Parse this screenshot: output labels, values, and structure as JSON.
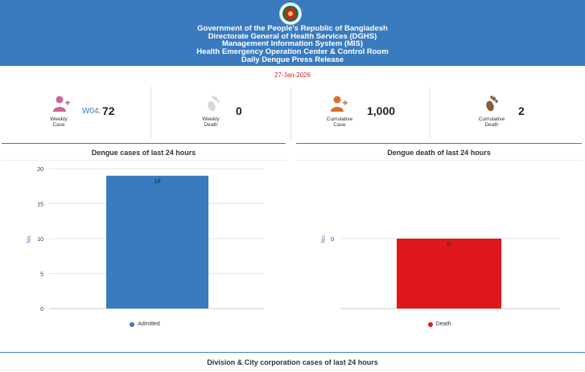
{
  "header": {
    "lines": [
      "Government of the People's Republic of Bangladesh",
      "Directorate General of Health Services (DGHS)",
      "Management Information System (MIS)",
      "Health Emergency Operation Center & Control Room",
      "Daily Dengue Press Release"
    ],
    "color": "#3a7bbf"
  },
  "date": "27-Jan-2026",
  "stats": [
    {
      "label_line1": "Weekly",
      "label_line2": "Case",
      "prefix": "W04:",
      "value": "72",
      "icon": "person-plus-icon"
    },
    {
      "label_line1": "Weekly",
      "label_line2": "Death",
      "prefix": "",
      "value": "0",
      "icon": "footprint-icon"
    },
    {
      "label_line1": "Cumulative",
      "label_line2": "Case",
      "prefix": "",
      "value": "1,000",
      "icon": "person-plus-icon"
    },
    {
      "label_line1": "Cumulative",
      "label_line2": "Death",
      "prefix": "",
      "value": "2",
      "icon": "footprint-icon"
    }
  ],
  "chart_data": [
    {
      "type": "bar",
      "title": "Dengue cases of last 24 hours",
      "ylabel": "No.",
      "ylim": [
        0,
        20
      ],
      "yticks": [
        "0",
        "5",
        "10",
        "15",
        "20"
      ],
      "series": [
        {
          "name": "Admitted",
          "values": [
            19
          ],
          "color": "#3a7bbf"
        }
      ],
      "data_labels": [
        "19"
      ],
      "grid": true,
      "legend": "bottom"
    },
    {
      "type": "bar",
      "title": "Dengue death of last 24 hours",
      "ylabel": "No.",
      "ylim": [
        0,
        0
      ],
      "yticks": [
        "0"
      ],
      "series": [
        {
          "name": "Death",
          "values": [
            0
          ],
          "color": "#e0161d"
        }
      ],
      "data_labels": [
        "0"
      ],
      "grid": true,
      "legend": "bottom"
    }
  ],
  "section": {
    "title": "Division & City corporation cases of last 24 hours"
  }
}
